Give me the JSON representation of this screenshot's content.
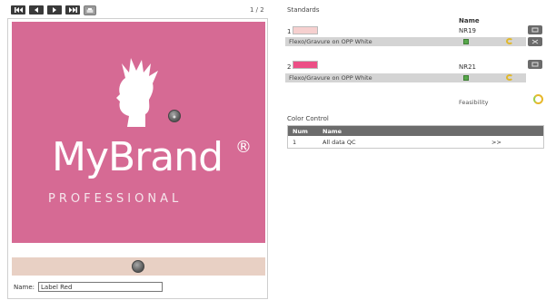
{
  "toolbar": {
    "buttons": [
      "first-page-icon",
      "previous-page-icon",
      "next-page-icon",
      "last-page-icon",
      "print-icon"
    ],
    "page_indicator": "1 / 2"
  },
  "label_preview": {
    "brand_name": "MyBrand",
    "brand_registered": "®",
    "brand_tagline": "PROFESSIONAL",
    "artwork_color": "#d66a94",
    "strip_color": "#e8d0c4",
    "name_label": "Name:",
    "name_value": "Label Red"
  },
  "standards": {
    "title": "Standards",
    "column_name": "Name",
    "items": [
      {
        "index": "1",
        "swatch_color": "#f6d0cf",
        "name": "NR19",
        "substrate": "Flexo/Gravure on OPP White"
      },
      {
        "index": "2",
        "swatch_color": "#ec4f86",
        "name": "NR21",
        "substrate": "Flexo/Gravure on OPP White"
      }
    ],
    "feasibility_label": "Feasibility"
  },
  "color_control": {
    "title": "Color Control",
    "columns": [
      "Num",
      "Name"
    ],
    "rows": [
      {
        "num": "1",
        "name": "All data QC",
        "action": ">>"
      }
    ]
  }
}
